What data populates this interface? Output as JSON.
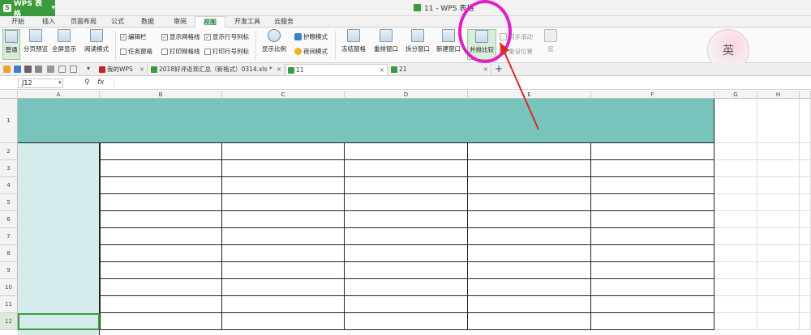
{
  "app": {
    "name": "WPS 表格",
    "logo": "S",
    "window_title": "11 - WPS 表格"
  },
  "menu": [
    "开始",
    "插入",
    "页面布局",
    "公式",
    "数据",
    "审阅",
    "视图",
    "开发工具",
    "云服务"
  ],
  "active_menu_index": 6,
  "ribbon": {
    "normal": "普通",
    "page_break": "分页预览",
    "fullscreen": "全屏显示",
    "reading_mode": "阅读模式",
    "edit_bar": "编辑栏",
    "task_pane": "任务窗格",
    "show_gridlines": "显示网格线",
    "print_gridlines": "打印网格线",
    "show_headers": "显示行号列标",
    "print_headers": "打印行号列标",
    "zoom": "显示比例",
    "eye_mode": "护眼模式",
    "night_mode": "夜间模式",
    "freeze": "冻结窗格",
    "arrange": "重排窗口",
    "split": "拆分窗口",
    "new_window": "新建窗口",
    "side_by_side": "并排比较",
    "sync_scroll": "同步滚动",
    "reset_position": "重设位置",
    "macro": "宏"
  },
  "avatar_text": "英",
  "doc_tabs": [
    {
      "label": "我的WPS",
      "close": "×"
    },
    {
      "label": "2018好评返现汇总（新格式）0314.xls *",
      "close": "×"
    },
    {
      "label": "11",
      "close": "×",
      "active": true
    },
    {
      "label": "21",
      "close": "×"
    }
  ],
  "new_tab": "+",
  "namebox": "J12",
  "fx": "fx",
  "columns": [
    "A",
    "B",
    "C",
    "D",
    "E",
    "F",
    "G",
    "H"
  ],
  "rows": [
    "1",
    "2",
    "3",
    "4",
    "5",
    "6",
    "7",
    "8",
    "9",
    "10",
    "11",
    "12"
  ],
  "colors": {
    "accent": "#3c9a3c",
    "header_fill": "#79c3bd",
    "col_a_fill": "#d6ecec",
    "highlight": "#e020c8",
    "arrow": "#d8282d"
  }
}
